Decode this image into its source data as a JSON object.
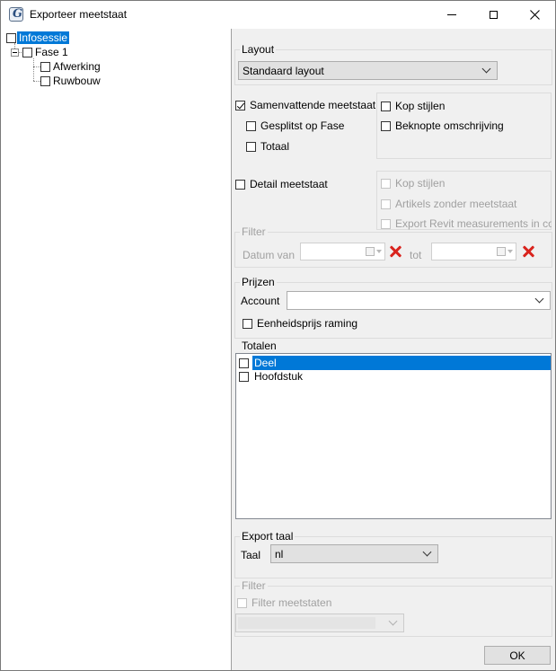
{
  "window": {
    "title": "Exporteer meetstaat",
    "app_icon_letter": "G"
  },
  "tree": {
    "root": {
      "label": "Infosessie"
    },
    "phase": {
      "label": "Fase 1"
    },
    "children": [
      {
        "label": "Afwerking"
      },
      {
        "label": "Ruwbouw"
      }
    ]
  },
  "layout": {
    "group_label": "Layout",
    "selected": "Standaard layout"
  },
  "summary": {
    "label": "Samenvattende meetstaat",
    "checked": true,
    "split_by_phase": "Gesplitst op Fase",
    "total": "Totaal",
    "style_headers": "Kop stijlen",
    "short_description": "Beknopte omschrijving"
  },
  "detail": {
    "label": "Detail meetstaat",
    "style_headers": "Kop stijlen",
    "items_without": "Artikels zonder meetstaat",
    "export_revit": "Export Revit measurements in colo"
  },
  "filter": {
    "group_label": "Filter",
    "date_from": "Datum van",
    "to": "tot"
  },
  "prices": {
    "group_label": "Prijzen",
    "account_label": "Account",
    "account_value": "",
    "unit_price": "Eenheidsprijs raming"
  },
  "totals": {
    "group_label": "Totalen",
    "items": [
      {
        "label": "Deel",
        "selected": true
      },
      {
        "label": "Hoofdstuk",
        "selected": false
      }
    ]
  },
  "export_language": {
    "group_label": "Export taal",
    "language_label": "Taal",
    "selected": "nl"
  },
  "filter2": {
    "group_label": "Filter",
    "filter_statements": "Filter meetstaten",
    "selected": ""
  },
  "buttons": {
    "ok": "OK"
  },
  "colors": {
    "selection": "#0078d7",
    "red_x": "#d9231d",
    "dialog_bg": "#f0f0f0"
  },
  "icons": [
    "app-icon",
    "minimize-icon",
    "maximize-icon",
    "close-icon",
    "tree-expander-icon",
    "calendar-icon",
    "clear-date-icon",
    "chevron-down-icon",
    "check-icon"
  ]
}
